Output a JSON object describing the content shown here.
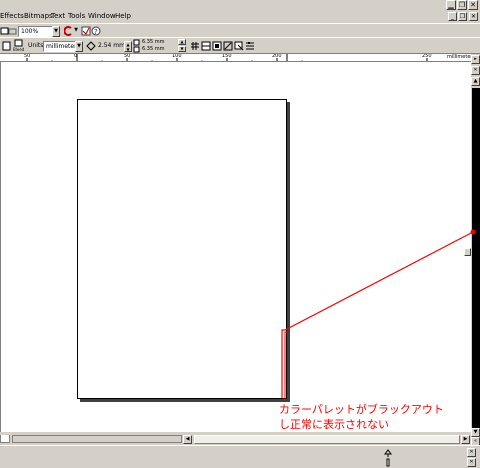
{
  "menu": {
    "items": [
      {
        "label": "Effects",
        "underline": "E"
      },
      {
        "label": "Bitmaps",
        "underline": "B"
      },
      {
        "label": "Text",
        "underline": "T"
      },
      {
        "label": "Tools",
        "underline": "o"
      },
      {
        "label": "Window",
        "underline": "W"
      },
      {
        "label": "Help",
        "underline": "H"
      }
    ]
  },
  "toolbar": {
    "zoom_value": "100%"
  },
  "property_bar": {
    "units_label": "Units",
    "units_value": "millimeters",
    "nudge_value": "2.54 mm",
    "dup_x_value": "6.35 mm",
    "dup_y_value": "6.35 mm"
  },
  "ruler": {
    "ticks": [
      "50",
      "0",
      "50",
      "100",
      "150",
      "200",
      "250"
    ],
    "units": "millimeters"
  },
  "annotation": {
    "line1": "カラーパレットがブラックアウト",
    "line2": "し正常に表示されない",
    "color": "#ff0000"
  },
  "colors": {
    "chrome": "#d4d0c8",
    "palette_black": "#000000",
    "annotation": "#ff0000"
  }
}
